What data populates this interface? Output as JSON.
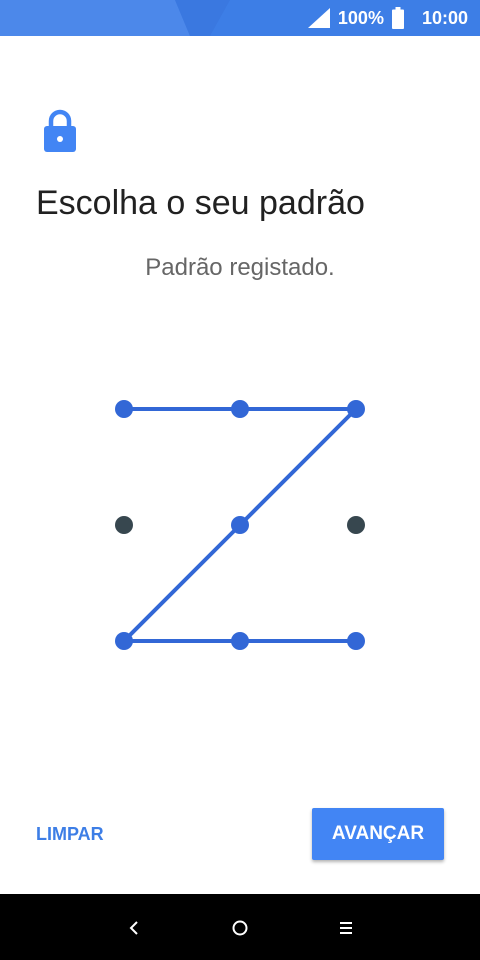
{
  "status_bar": {
    "battery_percent": "100%",
    "time": "10:00",
    "background_color": "#3d7ee6",
    "icons": [
      "signal-icon",
      "battery-icon"
    ]
  },
  "header": {
    "icon": "lock-icon",
    "title": "Escolha o seu padrão",
    "subtitle": "Padrão registado."
  },
  "pattern": {
    "dot_color_selected": "#3267d6",
    "dot_color_unselected": "#37474f",
    "line_color": "#3267d6",
    "selected_sequence": [
      1,
      2,
      3,
      5,
      7,
      8,
      9
    ],
    "unselected_dots": [
      4,
      6
    ]
  },
  "actions": {
    "clear_label": "LIMPAR",
    "next_label": "AVANÇAR"
  },
  "nav_bar": {
    "buttons": [
      "back-icon",
      "home-icon",
      "recents-icon"
    ]
  }
}
